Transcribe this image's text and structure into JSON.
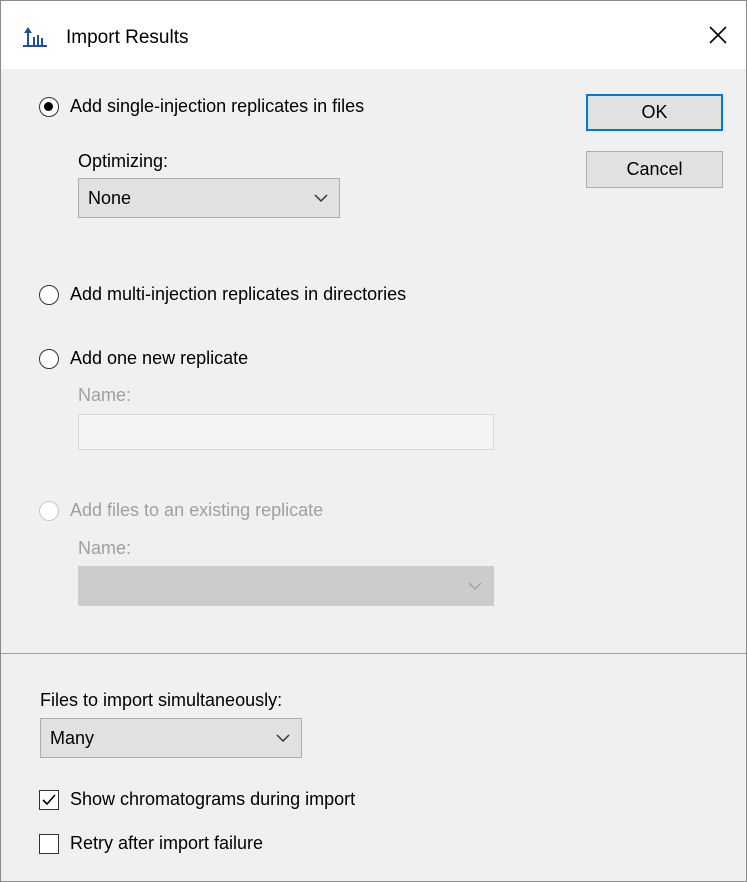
{
  "dialog": {
    "title": "Import Results",
    "close_glyph": "✕",
    "app_icon": "skyline-chart-icon"
  },
  "options": {
    "single_injection": {
      "label": "Add single-injection replicates in files",
      "checked": true,
      "optimizing_label": "Optimizing:",
      "optimizing_value": "None"
    },
    "multi_injection": {
      "label": "Add multi-injection replicates in directories",
      "checked": false
    },
    "new_replicate": {
      "label": "Add one new replicate",
      "checked": false,
      "name_label": "Name:",
      "name_value": ""
    },
    "existing_replicate": {
      "label": "Add files to an existing replicate",
      "checked": false,
      "disabled": true,
      "name_label": "Name:",
      "name_value": ""
    }
  },
  "buttons": {
    "ok_label": "OK",
    "cancel_label": "Cancel"
  },
  "bottom": {
    "files_simultaneous_label": "Files to import simultaneously:",
    "files_simultaneous_value": "Many",
    "show_chromatograms": {
      "label": "Show chromatograms during import",
      "checked": true
    },
    "retry_failure": {
      "label": "Retry after import failure",
      "checked": false
    }
  },
  "colors": {
    "default_button_border": "#0078d7",
    "disabled_text": "#a0a0a0",
    "dialog_background": "#f0f0f0"
  }
}
